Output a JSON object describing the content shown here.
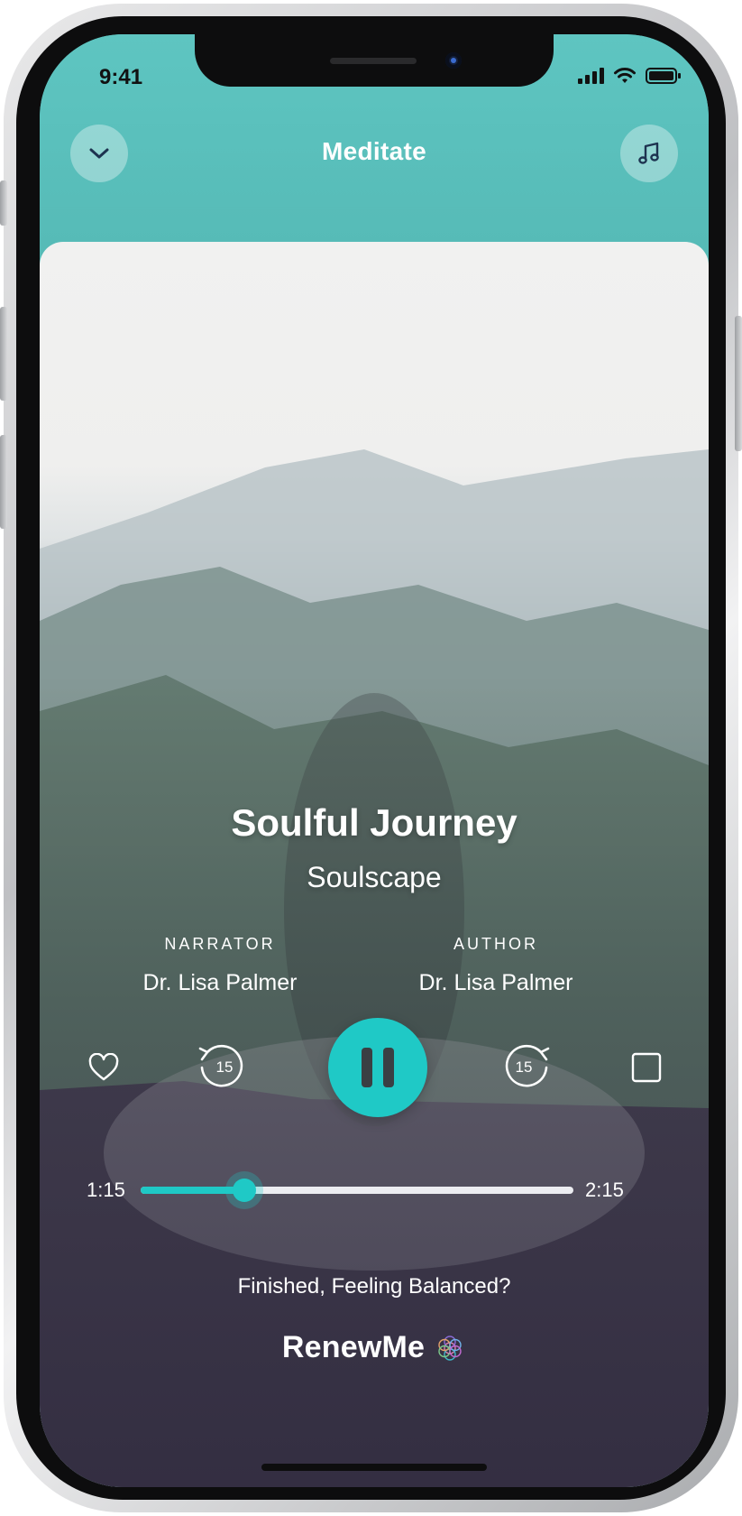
{
  "status_bar": {
    "time": "9:41"
  },
  "header": {
    "title": "Meditate",
    "collapse_icon": "chevron-down-icon",
    "music_icon": "music-note-icon"
  },
  "track": {
    "title": "Soulful Journey",
    "subtitle": "Soulscape"
  },
  "credits": {
    "narrator_label": "NARRATOR",
    "narrator_name": "Dr. Lisa Palmer",
    "author_label": "AUTHOR",
    "author_name": "Dr. Lisa Palmer"
  },
  "controls": {
    "rewind_seconds": "15",
    "forward_seconds": "15",
    "state": "playing"
  },
  "progress": {
    "elapsed": "1:15",
    "total": "2:15",
    "fraction": 0.24
  },
  "footer": {
    "prompt": "Finished, Feeling Balanced?",
    "brand": "RenewMe"
  },
  "colors": {
    "accent": "#1fc9c6",
    "header": "#5cc3c0"
  }
}
